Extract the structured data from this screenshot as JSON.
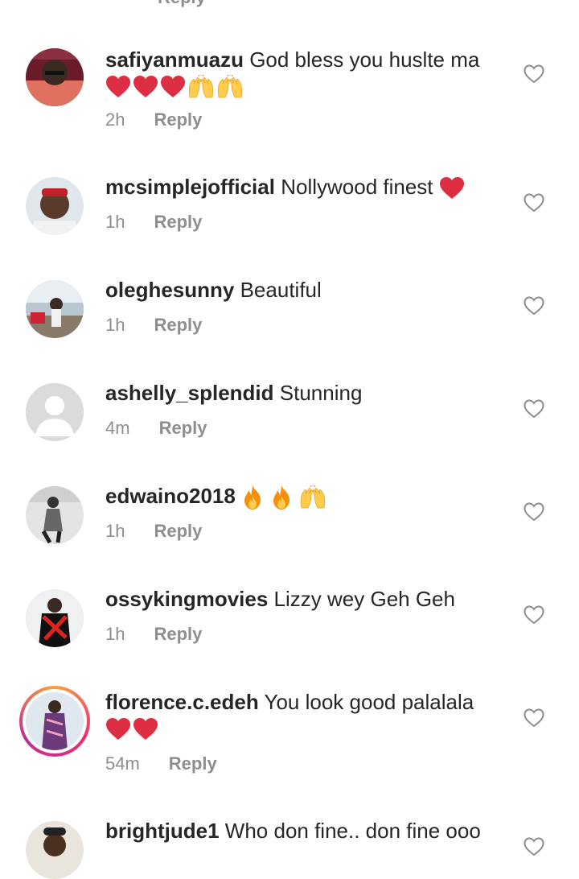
{
  "top_fragment": {
    "reply_label": "Reply"
  },
  "comments": [
    {
      "username": "safiyanmuazu",
      "text": "God bless you huslte ma",
      "time": "2h",
      "reply": "Reply"
    },
    {
      "username": "mcsimplejofficial",
      "text": "Nollywood finest",
      "time": "1h",
      "reply": "Reply"
    },
    {
      "username": "oleghesunny",
      "text": "Beautiful",
      "time": "1h",
      "reply": "Reply"
    },
    {
      "username": "ashelly_splendid",
      "text": "Stunning",
      "time": "4m",
      "reply": "Reply"
    },
    {
      "username": "edwaino2018",
      "text": "",
      "time": "1h",
      "reply": "Reply"
    },
    {
      "username": "ossykingmovies",
      "text": "Lizzy wey Geh Geh",
      "time": "1h",
      "reply": "Reply"
    },
    {
      "username": "florence.c.edeh",
      "text": "You look good palalala",
      "time": "54m",
      "reply": "Reply"
    },
    {
      "username": "brightjude1",
      "text": "Who don fine.. don fine ooo",
      "time": "",
      "reply": ""
    }
  ],
  "colors": {
    "username": "#262626",
    "meta": "#8e8e8e",
    "heart": "#e0245e",
    "like_outline": "#8e8e8e"
  },
  "icons": {
    "like": "heart-outline-icon",
    "heart_emoji": "red-heart-emoji",
    "hands_emoji": "raising-hands-emoji",
    "fire_emoji": "fire-emoji"
  }
}
